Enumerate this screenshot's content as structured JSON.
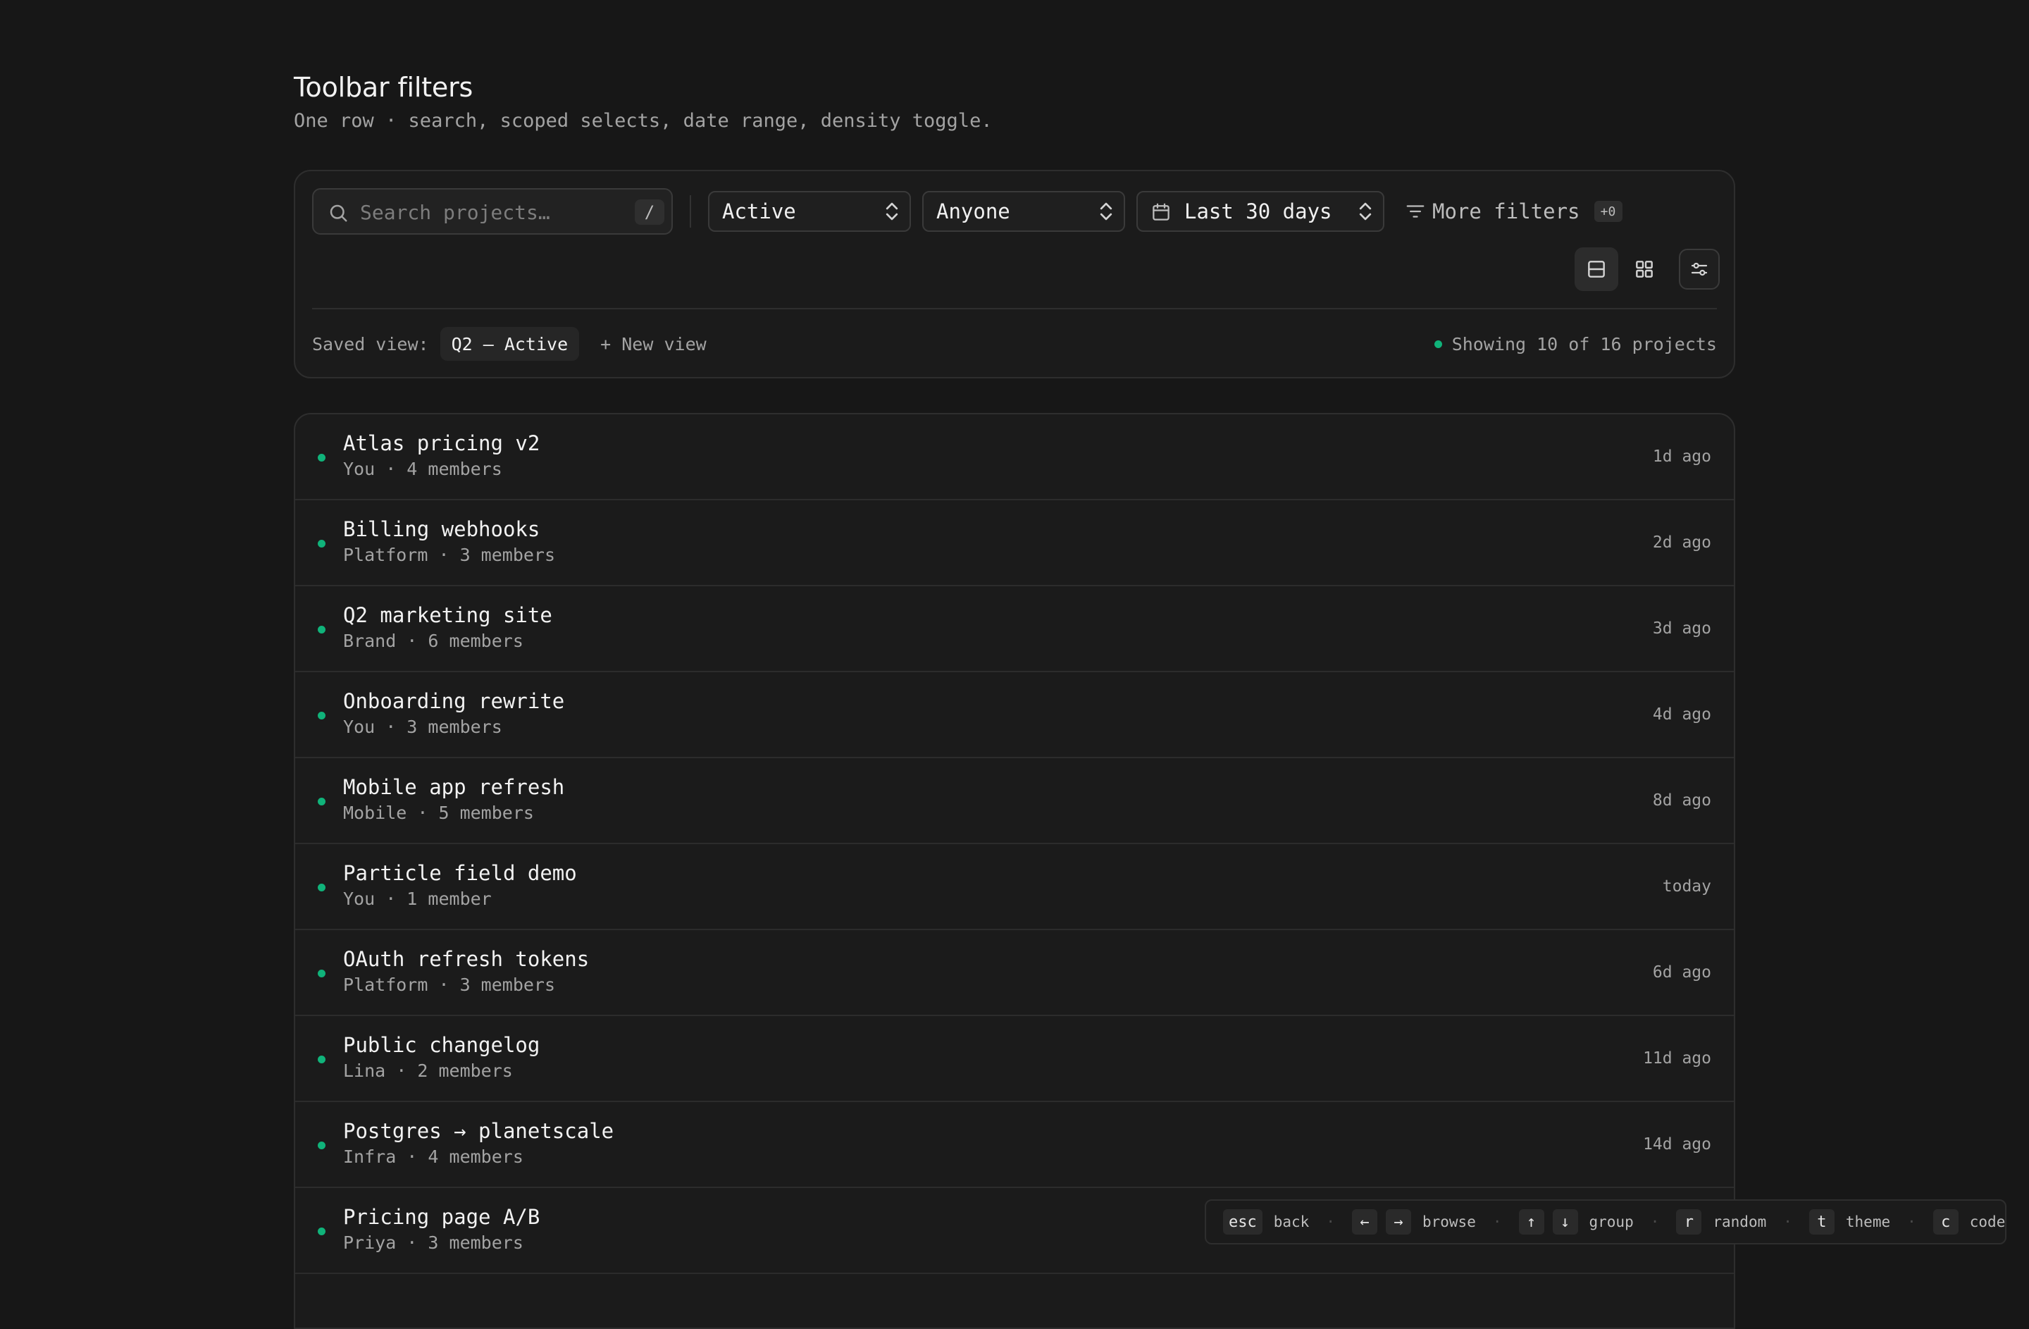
{
  "header": {
    "title": "Toolbar filters",
    "subtitle": "One row · search, scoped selects, date range, density toggle."
  },
  "toolbar": {
    "search_placeholder": "Search projects…",
    "search_value": "",
    "search_shortcut": "/",
    "status_select": {
      "value": "Active"
    },
    "owner_select": {
      "value": "Anyone"
    },
    "date_select": {
      "value": "Last 30 days"
    },
    "more_filters_label": "More filters",
    "more_filters_count": "+0",
    "density_selected": "list"
  },
  "saved_views": {
    "label": "Saved view:",
    "current": "Q2 — Active",
    "new_view_label": "+ New view",
    "showing_text": "Showing 10 of 16 projects"
  },
  "projects": [
    {
      "title": "Atlas pricing v2",
      "meta": "You · 4 members",
      "time": "1d ago"
    },
    {
      "title": "Billing webhooks",
      "meta": "Platform · 3 members",
      "time": "2d ago"
    },
    {
      "title": "Q2 marketing site",
      "meta": "Brand · 6 members",
      "time": "3d ago"
    },
    {
      "title": "Onboarding rewrite",
      "meta": "You · 3 members",
      "time": "4d ago"
    },
    {
      "title": "Mobile app refresh",
      "meta": "Mobile · 5 members",
      "time": "8d ago"
    },
    {
      "title": "Particle field demo",
      "meta": "You · 1 member",
      "time": "today"
    },
    {
      "title": "OAuth refresh tokens",
      "meta": "Platform · 3 members",
      "time": "6d ago"
    },
    {
      "title": "Public changelog",
      "meta": "Lina · 2 members",
      "time": "11d ago"
    },
    {
      "title": "Postgres → planetscale",
      "meta": "Infra · 4 members",
      "time": "14d ago"
    },
    {
      "title": "Pricing page A/B",
      "meta": "Priya · 3 members",
      "time": ""
    }
  ],
  "shortcuts": {
    "esc_key": "esc",
    "esc_label": "back",
    "left_key": "←",
    "right_key": "→",
    "browse_label": "browse",
    "up_key": "↑",
    "down_key": "↓",
    "group_label": "group",
    "r_key": "r",
    "random_label": "random",
    "t_key": "t",
    "theme_label": "theme",
    "c_key": "c",
    "code_label": "code",
    "separator": "·"
  },
  "colors": {
    "background": "#171717",
    "card": "#1b1b1b",
    "border": "#2e2e2e",
    "status_active": "#10b37a"
  }
}
